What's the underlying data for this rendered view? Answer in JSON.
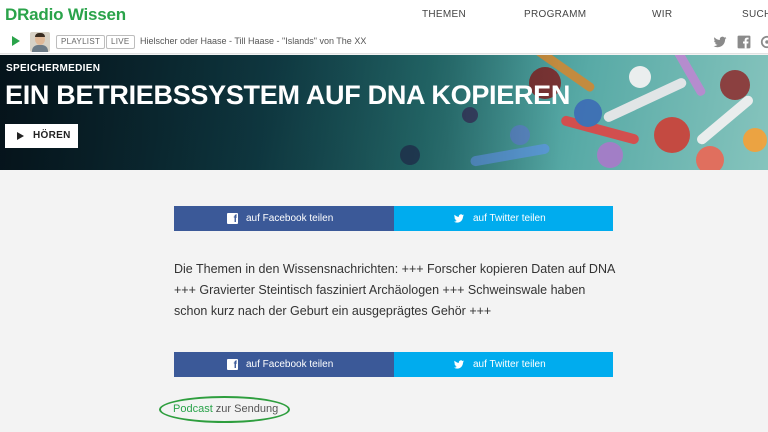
{
  "header": {
    "logo": "DRadio Wissen",
    "nav": [
      "THEMEN",
      "PROGRAMM",
      "WIR",
      "SUCH"
    ]
  },
  "player": {
    "playlist_label": "PLAYLIST",
    "live_label": "LIVE",
    "now_playing": "Hielscher oder Haase - Till Haase - \"Islands\" von The XX",
    "social": [
      "twitter-icon",
      "facebook-icon",
      "settings-icon"
    ]
  },
  "hero": {
    "kicker": "SPEICHERMEDIEN",
    "title": "EIN BETRIEBSSYSTEM AUF DNA KOPIEREN",
    "listen_label": "HÖREN"
  },
  "share": {
    "facebook_label": "auf Facebook teilen",
    "twitter_label": "auf Twitter teilen"
  },
  "article": {
    "text": "Die Themen in den Wissensnachrichten: +++ Forscher kopieren Daten auf DNA +++ Gravierter Steintisch fasziniert Archäologen +++ Schweinswale haben schon kurz nach der Geburt ein ausgeprägtes Gehör +++"
  },
  "podcast": {
    "link": "Podcast",
    "rest": " zur Sendung"
  },
  "colors": {
    "brand_green": "#2aa34a",
    "facebook_blue": "#3b5998",
    "twitter_blue": "#00acee",
    "annotation_circle": "#2e9e3e"
  }
}
